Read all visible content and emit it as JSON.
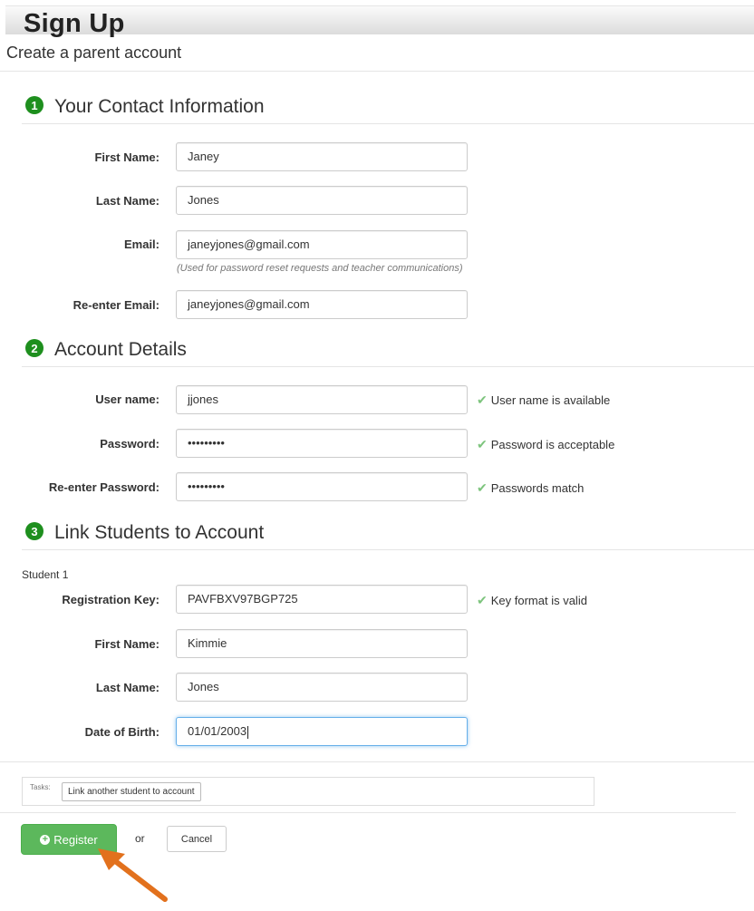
{
  "header": {
    "title": "Sign Up",
    "subtitle": "Create a parent account"
  },
  "sections": [
    {
      "number": "1",
      "title": "Your Contact Information"
    },
    {
      "number": "2",
      "title": "Account Details"
    },
    {
      "number": "3",
      "title": "Link Students to Account"
    }
  ],
  "contact": {
    "first_name": {
      "label": "First Name:",
      "value": "Janey"
    },
    "last_name": {
      "label": "Last Name:",
      "value": "Jones"
    },
    "email": {
      "label": "Email:",
      "value": "janeyjones@gmail.com",
      "help": "(Used for password reset requests and teacher communications)"
    },
    "reenter_email": {
      "label": "Re-enter Email:",
      "value": "janeyjones@gmail.com"
    }
  },
  "account": {
    "username": {
      "label": "User name:",
      "value": "jjones",
      "status": "User name is available"
    },
    "password": {
      "label": "Password:",
      "value": "•••••••••",
      "status": "Password is acceptable"
    },
    "reenter_password": {
      "label": "Re-enter Password:",
      "value": "•••••••••",
      "status": "Passwords match"
    }
  },
  "student": {
    "heading": "Student 1",
    "registration_key": {
      "label": "Registration Key:",
      "value": "PAVFBXV97BGP725",
      "status": "Key format is valid"
    },
    "first_name": {
      "label": "First Name:",
      "value": "Kimmie"
    },
    "last_name": {
      "label": "Last Name:",
      "value": "Jones"
    },
    "dob": {
      "label": "Date of Birth:",
      "value": "01/01/2003"
    }
  },
  "tasks": {
    "label": "Tasks:",
    "link_button": "Link another student to account"
  },
  "actions": {
    "register": "Register",
    "or": "or",
    "cancel": "Cancel"
  },
  "colors": {
    "accent_green": "#5cb85c",
    "step_badge": "#1e8f1e",
    "check": "#7dc47d",
    "arrow": "#e2711d"
  },
  "icons": {
    "step_badge": "numbered-circle-icon",
    "valid": "check-icon",
    "register": "plus-circle-icon",
    "pointer": "arrow-icon"
  }
}
